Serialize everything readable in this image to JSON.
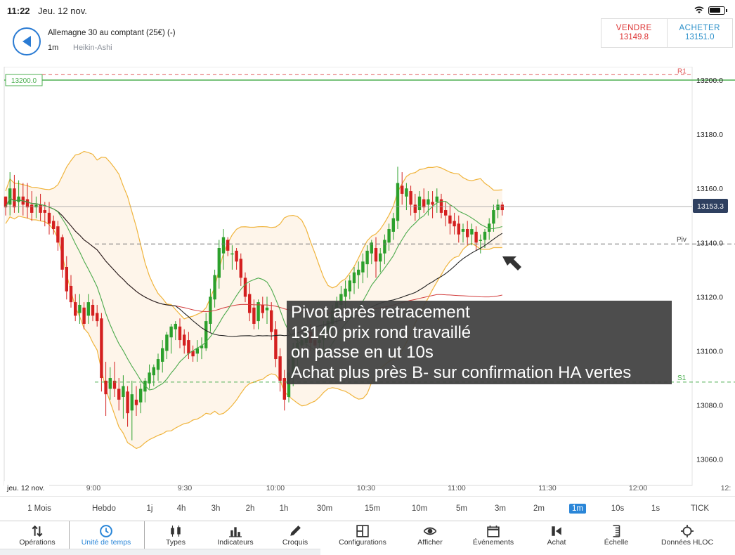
{
  "status": {
    "time": "11:22",
    "date": "Jeu. 12 nov."
  },
  "header": {
    "instrument": "Allemagne 30 au comptant (25€) (-)",
    "timeframe": "1m",
    "chart_type": "Heikin-Ashi"
  },
  "trade": {
    "sell_label": "VENDRE",
    "sell_price": "13149.8",
    "buy_label": "ACHETER",
    "buy_price": "13151.0"
  },
  "colors": {
    "accent": "#2a86d8",
    "bull": "#2ca02c",
    "bear": "#d42020",
    "resistance": "#e05a5a",
    "support": "#4caf50",
    "bollinger": "#f0b43c",
    "ma_long": "#d23c3c",
    "ma_mid": "#4caa4c",
    "ma_fast": "#222222"
  },
  "chart_data": {
    "type": "candlestick",
    "chart_style": "Heikin-Ashi",
    "y_axis": {
      "ticks": [
        "13200.0",
        "13180.0",
        "13160.0",
        "13140.0",
        "13120.0",
        "13100.0",
        "13080.0",
        "13060.0"
      ],
      "range": [
        13053,
        13223
      ]
    },
    "x_axis": {
      "start_label": "jeu. 12 nov.",
      "ticks": [
        "9:00",
        "9:30",
        "10:00",
        "10:30",
        "11:00",
        "11:30",
        "12:00",
        "12:"
      ]
    },
    "price_tag": "13153.3",
    "levels": [
      {
        "label": "13200.0",
        "value": 13200.0
      },
      {
        "label": "R1",
        "value": 13202.0
      },
      {
        "label": "Piv",
        "value": 13139.5
      },
      {
        "label": "S1",
        "value": 13088.5
      }
    ],
    "bars_ohlc": [
      [
        13157,
        13157,
        13150,
        13153
      ],
      [
        13154,
        13166,
        13150,
        13160
      ],
      [
        13160,
        13165,
        13151,
        13153
      ],
      [
        13155,
        13163,
        13151,
        13157
      ],
      [
        13157,
        13162,
        13150,
        13154
      ],
      [
        13156,
        13162,
        13149,
        13153
      ],
      [
        13154,
        13159,
        13148,
        13151
      ],
      [
        13153,
        13157,
        13149,
        13154
      ],
      [
        13154,
        13158,
        13148,
        13151
      ],
      [
        13152,
        13155,
        13146,
        13151
      ],
      [
        13151,
        13155,
        13143,
        13147
      ],
      [
        13148,
        13150,
        13143,
        13145
      ],
      [
        13146,
        13148,
        13137,
        13140
      ],
      [
        13142,
        13143,
        13127,
        13130
      ],
      [
        13131,
        13135,
        13119,
        13122
      ],
      [
        13124,
        13128,
        13116,
        13118
      ],
      [
        13118,
        13121,
        13111,
        13113
      ],
      [
        13114,
        13121,
        13110,
        13117
      ],
      [
        13116,
        13118,
        13108,
        13110
      ],
      [
        13113,
        13121,
        13110,
        13118
      ],
      [
        13117,
        13119,
        13111,
        13113
      ],
      [
        13114,
        13117,
        13109,
        13111
      ],
      [
        13112,
        13114,
        13085,
        13090
      ],
      [
        13089,
        13096,
        13076,
        13084
      ],
      [
        13086,
        13094,
        13082,
        13090
      ],
      [
        13089,
        13096,
        13083,
        13086
      ],
      [
        13086,
        13090,
        13078,
        13082
      ],
      [
        13083,
        13091,
        13075,
        13087
      ],
      [
        13085,
        13087,
        13072,
        13077
      ],
      [
        13078,
        13089,
        13067,
        13084
      ],
      [
        13082,
        13087,
        13076,
        13080
      ],
      [
        13081,
        13088,
        13077,
        13086
      ],
      [
        13085,
        13090,
        13081,
        13089
      ],
      [
        13088,
        13095,
        13086,
        13092
      ],
      [
        13091,
        13095,
        13087,
        13094
      ],
      [
        13093,
        13099,
        13089,
        13097
      ],
      [
        13096,
        13104,
        13092,
        13101
      ],
      [
        13100,
        13107,
        13097,
        13106
      ],
      [
        13105,
        13110,
        13099,
        13109
      ],
      [
        13108,
        13111,
        13104,
        13110
      ],
      [
        13109,
        13112,
        13101,
        13104
      ],
      [
        13106,
        13108,
        13099,
        13102
      ],
      [
        13104,
        13107,
        13097,
        13099
      ],
      [
        13100,
        13102,
        13096,
        13098
      ],
      [
        13099,
        13104,
        13096,
        13101
      ],
      [
        13101,
        13105,
        13097,
        13102
      ],
      [
        13101,
        13114,
        13100,
        13111
      ],
      [
        13110,
        13123,
        13107,
        13120
      ],
      [
        13119,
        13130,
        13116,
        13128
      ],
      [
        13127,
        13141,
        13123,
        13138
      ],
      [
        13136,
        13145,
        13130,
        13142
      ],
      [
        13141,
        13142,
        13135,
        13137
      ],
      [
        13136,
        13139,
        13130,
        13136
      ],
      [
        13137,
        13138,
        13130,
        13133
      ],
      [
        13134,
        13136,
        13124,
        13127
      ],
      [
        13127,
        13129,
        13118,
        13120
      ],
      [
        13121,
        13125,
        13111,
        13114
      ],
      [
        13116,
        13119,
        13108,
        13110
      ],
      [
        13111,
        13119,
        13108,
        13118
      ],
      [
        13117,
        13120,
        13112,
        13114
      ],
      [
        13115,
        13120,
        13110,
        13116
      ],
      [
        13115,
        13118,
        13104,
        13107
      ],
      [
        13108,
        13111,
        13094,
        13097
      ],
      [
        13098,
        13101,
        13085,
        13089
      ],
      [
        13090,
        13093,
        13078,
        13082
      ],
      [
        13083,
        13097,
        13081,
        13092
      ],
      [
        13091,
        13103,
        13087,
        13100
      ],
      [
        13099,
        13106,
        13094,
        13103
      ],
      [
        13102,
        13106,
        13098,
        13104
      ],
      [
        13103,
        13110,
        13100,
        13108
      ],
      [
        13107,
        13110,
        13100,
        13103
      ],
      [
        13104,
        13107,
        13099,
        13102
      ],
      [
        13103,
        13106,
        13097,
        13104
      ],
      [
        13104,
        13111,
        13100,
        13108
      ],
      [
        13107,
        13114,
        13104,
        13111
      ],
      [
        13110,
        13117,
        13106,
        13115
      ],
      [
        13114,
        13120,
        13110,
        13118
      ],
      [
        13117,
        13124,
        13114,
        13121
      ],
      [
        13120,
        13126,
        13116,
        13123
      ],
      [
        13122,
        13128,
        13119,
        13126
      ],
      [
        13125,
        13131,
        13121,
        13129
      ],
      [
        13128,
        13133,
        13123,
        13130
      ],
      [
        13129,
        13136,
        13125,
        13133
      ],
      [
        13132,
        13139,
        13127,
        13137
      ],
      [
        13136,
        13141,
        13132,
        13140
      ],
      [
        13138,
        13142,
        13127,
        13133
      ],
      [
        13133,
        13138,
        13129,
        13136
      ],
      [
        13136,
        13143,
        13132,
        13141
      ],
      [
        13140,
        13147,
        13137,
        13145
      ],
      [
        13144,
        13151,
        13141,
        13149
      ],
      [
        13148,
        13168,
        13145,
        13162
      ],
      [
        13161,
        13166,
        13154,
        13158
      ],
      [
        13157,
        13162,
        13152,
        13160
      ],
      [
        13159,
        13161,
        13150,
        13154
      ],
      [
        13154,
        13158,
        13148,
        13151
      ],
      [
        13152,
        13159,
        13149,
        13157
      ],
      [
        13156,
        13160,
        13151,
        13153
      ],
      [
        13154,
        13159,
        13150,
        13156
      ],
      [
        13155,
        13159,
        13149,
        13154
      ],
      [
        13155,
        13160,
        13151,
        13157
      ],
      [
        13156,
        13158,
        13149,
        13151
      ],
      [
        13152,
        13155,
        13146,
        13150
      ],
      [
        13150,
        13154,
        13143,
        13147
      ],
      [
        13148,
        13151,
        13143,
        13146
      ],
      [
        13147,
        13150,
        13140,
        13143
      ],
      [
        13144,
        13147,
        13140,
        13145
      ],
      [
        13145,
        13148,
        13139,
        13142
      ],
      [
        13143,
        13147,
        13139,
        13145
      ],
      [
        13144,
        13146,
        13137,
        13140
      ],
      [
        13141,
        13143,
        13136,
        13141
      ],
      [
        13141,
        13145,
        13138,
        13144
      ],
      [
        13144,
        13149,
        13141,
        13147
      ],
      [
        13147,
        13154,
        13144,
        13152
      ],
      [
        13152,
        13156,
        13149,
        13154
      ],
      [
        13154,
        13155,
        13150,
        13152
      ]
    ]
  },
  "annotation": {
    "line1": "Pivot après retracement",
    "line2": "13140 prix rond travaillé",
    "line3": "on passe en ut 10s",
    "line4": "Achat plus près B- sur confirmation HA vertes"
  },
  "timeframes": [
    "1 Mois",
    "Hebdo",
    "1j",
    "4h",
    "3h",
    "2h",
    "1h",
    "30m",
    "15m",
    "10m",
    "5m",
    "3m",
    "2m",
    "1m",
    "10s",
    "1s",
    "TICK"
  ],
  "active_timeframe": "1m",
  "toolbar": [
    {
      "label": "Opérations",
      "icon": "sort-arrows-icon"
    },
    {
      "label": "Unité de temps",
      "icon": "clock-icon"
    },
    {
      "label": "Types",
      "icon": "candles-icon"
    },
    {
      "label": "Indicateurs",
      "icon": "bar-chart-icon"
    },
    {
      "label": "Croquis",
      "icon": "pencil-icon"
    },
    {
      "label": "Configurations",
      "icon": "layout-icon"
    },
    {
      "label": "Afficher",
      "icon": "eye-icon"
    },
    {
      "label": "Événements",
      "icon": "calendar-icon"
    },
    {
      "label": "Achat",
      "icon": "buy-flag-icon"
    },
    {
      "label": "Échelle",
      "icon": "scale-icon"
    },
    {
      "label": "Données HLOC",
      "icon": "crosshair-icon"
    }
  ]
}
